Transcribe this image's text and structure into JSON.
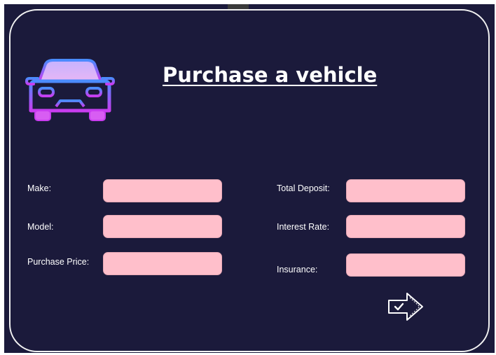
{
  "form": {
    "title": "Purchase a vehicle",
    "fields": {
      "make": {
        "label": "Make:",
        "value": ""
      },
      "model": {
        "label": "Model:",
        "value": ""
      },
      "purchase_price": {
        "label": "Purchase Price:",
        "value": ""
      },
      "total_deposit": {
        "label": "Total Deposit:",
        "value": ""
      },
      "interest_rate": {
        "label": "Interest Rate:",
        "value": ""
      },
      "insurance": {
        "label": "Insurance:",
        "value": ""
      }
    },
    "submit_icon": "arrow-right-check-icon",
    "logo_icon": "car-icon"
  },
  "colors": {
    "background": "#1b1a3b",
    "frame": "#f2f2f2",
    "field": "#ffbfcb",
    "car_gradient_top": "#4a8cff",
    "car_gradient_bottom": "#c93cf0"
  }
}
